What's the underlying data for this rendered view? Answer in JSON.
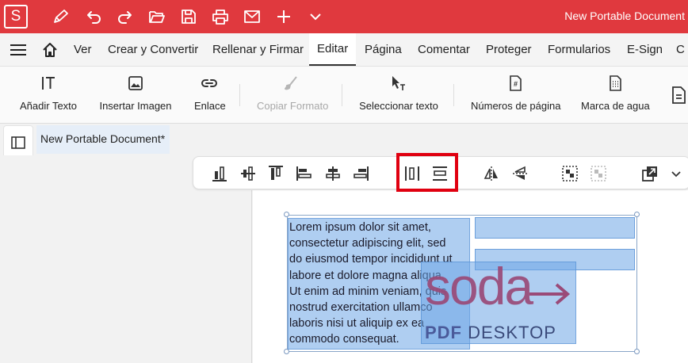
{
  "titlebar": {
    "logo_letter": "S",
    "app_title": "New Portable Document",
    "icons": [
      "pen-icon",
      "undo-icon",
      "redo-icon",
      "open-folder-icon",
      "save-icon",
      "print-icon",
      "mail-icon",
      "plus-icon",
      "chevron-down-icon"
    ],
    "color": "#e0393e"
  },
  "menubar": {
    "items": [
      "Ver",
      "Crear y Convertir",
      "Rellenar y Firmar",
      "Editar",
      "Página",
      "Comentar",
      "Proteger",
      "Formularios",
      "E-Sign",
      "C"
    ],
    "active": "Editar"
  },
  "ribbon": {
    "tools": [
      {
        "label": "Añadir Texto",
        "icon": "add-text-icon"
      },
      {
        "label": "Insertar Imagen",
        "icon": "image-icon"
      },
      {
        "label": "Enlace",
        "icon": "link-icon"
      },
      {
        "label": "Copiar Formato",
        "icon": "format-painter-icon",
        "disabled": true
      },
      {
        "label": "Seleccionar texto",
        "icon": "select-text-icon"
      },
      {
        "label": "Números de página",
        "icon": "page-numbers-icon"
      },
      {
        "label": "Marca de agua",
        "icon": "watermark-icon"
      }
    ]
  },
  "document": {
    "tab_title": "New Portable Document*",
    "lines": [
      "Lorem ipsum dolor sit amet,",
      "consectetur adipiscing elit, sed",
      "do eiusmod tempor incididunt ut",
      "labore et dolore magna aliqua.",
      "Ut enim ad minim veniam, quis",
      "nostrud exercitation ullamco",
      "laboris nisi ut aliquip ex ea",
      "commodo consequat."
    ],
    "logo": {
      "word": "soda",
      "pdf": "PDF",
      "desktop": "DESKTOP"
    }
  },
  "colors": {
    "accent": "#e0393e",
    "selection": "#6ea5e6",
    "highlight_box": "#e00010",
    "logo_magenta": "#9a4a78",
    "logo_blue": "#4a5a9a"
  }
}
